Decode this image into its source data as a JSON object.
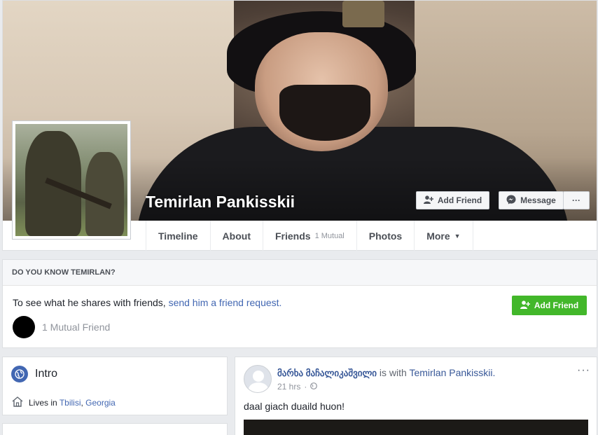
{
  "profile": {
    "name": "Temirlan Pankisskii"
  },
  "actions": {
    "add_friend_label": "Add Friend",
    "message_label": "Message",
    "more_label": "···"
  },
  "tabs": [
    {
      "label": "Timeline"
    },
    {
      "label": "About"
    },
    {
      "label": "Friends",
      "extra": "1 Mutual"
    },
    {
      "label": "Photos"
    },
    {
      "label": "More"
    }
  ],
  "know": {
    "heading": "DO YOU KNOW TEMIRLAN?",
    "text": "To see what he shares with friends, ",
    "link": "send him a friend request.",
    "button_label": "Add Friend",
    "mutual": "1 Mutual Friend"
  },
  "intro": {
    "title": "Intro",
    "lives_prefix": "Lives in ",
    "city": "Tbilisi",
    "separator": ", ",
    "country": "Georgia"
  },
  "post": {
    "author": "მარხა მაჩალიკაშვილი",
    "with_text": " is with ",
    "tagged": "Temirlan Pankisskii.",
    "time": "21 hrs",
    "time_separator": "·",
    "dots": "···",
    "text": "daal giach duaild huon!"
  },
  "icons": {
    "add_friend": "person-plus-icon",
    "message": "messenger-icon",
    "intro": "globe-icon",
    "home": "home-icon",
    "privacy": "globe-small-icon",
    "more_caret": "caret-down-icon"
  },
  "colors": {
    "link": "#4267b2",
    "green": "#42b72a",
    "background": "#e9ebee"
  }
}
